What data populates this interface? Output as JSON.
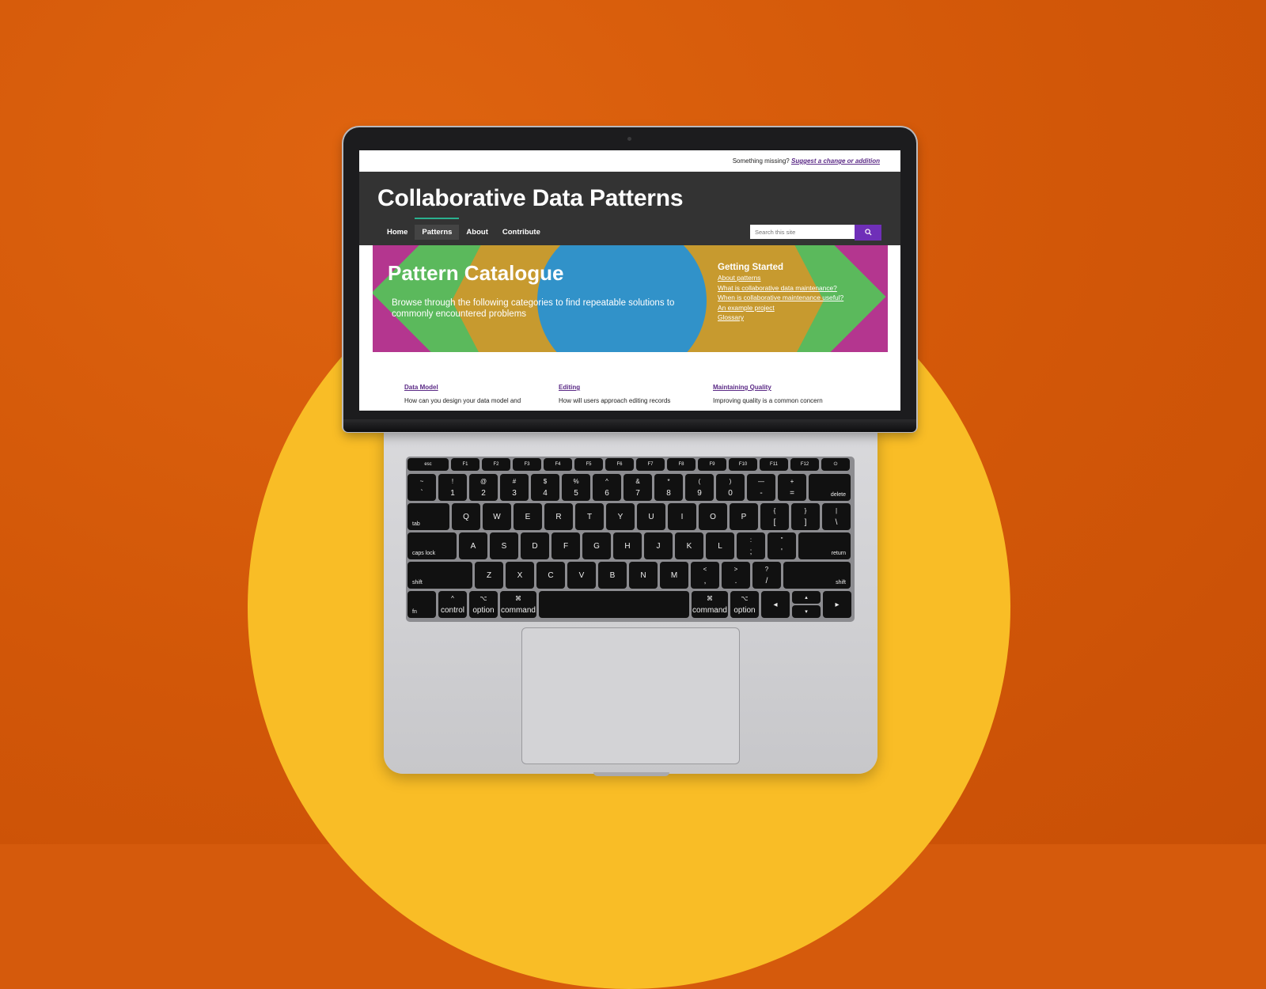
{
  "topbar": {
    "prefix": "Something missing?",
    "link": "Suggest a change or addition"
  },
  "site": {
    "title": "Collaborative Data Patterns"
  },
  "nav": [
    {
      "label": "Home"
    },
    {
      "label": "Patterns"
    },
    {
      "label": "About"
    },
    {
      "label": "Contribute"
    }
  ],
  "search": {
    "placeholder": "Search this site",
    "button_icon": "search-icon"
  },
  "hero": {
    "title": "Pattern Catalogue",
    "subtitle": "Browse through the following categories to find repeatable solutions to commonly encountered problems"
  },
  "getting_started": {
    "heading": "Getting Started",
    "links": [
      "About patterns",
      "What is collaborative data maintenance?",
      "When is collaborative maintenance useful?",
      "An example project",
      "Glossary"
    ]
  },
  "cards": [
    {
      "title": "Data Model",
      "desc": "How can you design your data model and"
    },
    {
      "title": "Editing",
      "desc": "How will users approach editing records"
    },
    {
      "title": "Maintaining Quality",
      "desc": "Improving quality is a common concern"
    }
  ],
  "keyboard": {
    "fn_row": [
      "esc",
      "F1",
      "F2",
      "F3",
      "F4",
      "F5",
      "F6",
      "F7",
      "F8",
      "F9",
      "F10",
      "F11",
      "F12",
      "⏻"
    ],
    "num_row": [
      [
        "~",
        "`"
      ],
      [
        "!",
        "1"
      ],
      [
        "@",
        "2"
      ],
      [
        "#",
        "3"
      ],
      [
        "$",
        "4"
      ],
      [
        "%",
        "5"
      ],
      [
        "^",
        "6"
      ],
      [
        "&",
        "7"
      ],
      [
        "*",
        "8"
      ],
      [
        "(",
        "9"
      ],
      [
        ")",
        "0"
      ],
      [
        "—",
        "-"
      ],
      [
        "+",
        "="
      ]
    ],
    "delete": "delete",
    "tab": "tab",
    "q_row": [
      "Q",
      "W",
      "E",
      "R",
      "T",
      "Y",
      "U",
      "I",
      "O",
      "P"
    ],
    "q_sym": [
      [
        "{",
        "["
      ],
      [
        "}",
        "]"
      ],
      [
        "|",
        "\\"
      ]
    ],
    "caps": "caps lock",
    "a_row": [
      "A",
      "S",
      "D",
      "F",
      "G",
      "H",
      "J",
      "K",
      "L"
    ],
    "a_sym": [
      [
        ":",
        ";"
      ],
      [
        "\"",
        "'"
      ]
    ],
    "return": "return",
    "shift": "shift",
    "z_row": [
      "Z",
      "X",
      "C",
      "V",
      "B",
      "N",
      "M"
    ],
    "z_sym": [
      [
        "<",
        ","
      ],
      [
        ">",
        "."
      ],
      [
        "?",
        "/"
      ]
    ],
    "bottom": [
      "fn",
      "control",
      "option",
      "command",
      "command",
      "option"
    ],
    "bottom_sym": [
      "^",
      "⌥",
      "⌘",
      "⌘",
      "⌥"
    ],
    "arrows": [
      "◂",
      "▴",
      "▾",
      "▸"
    ]
  }
}
